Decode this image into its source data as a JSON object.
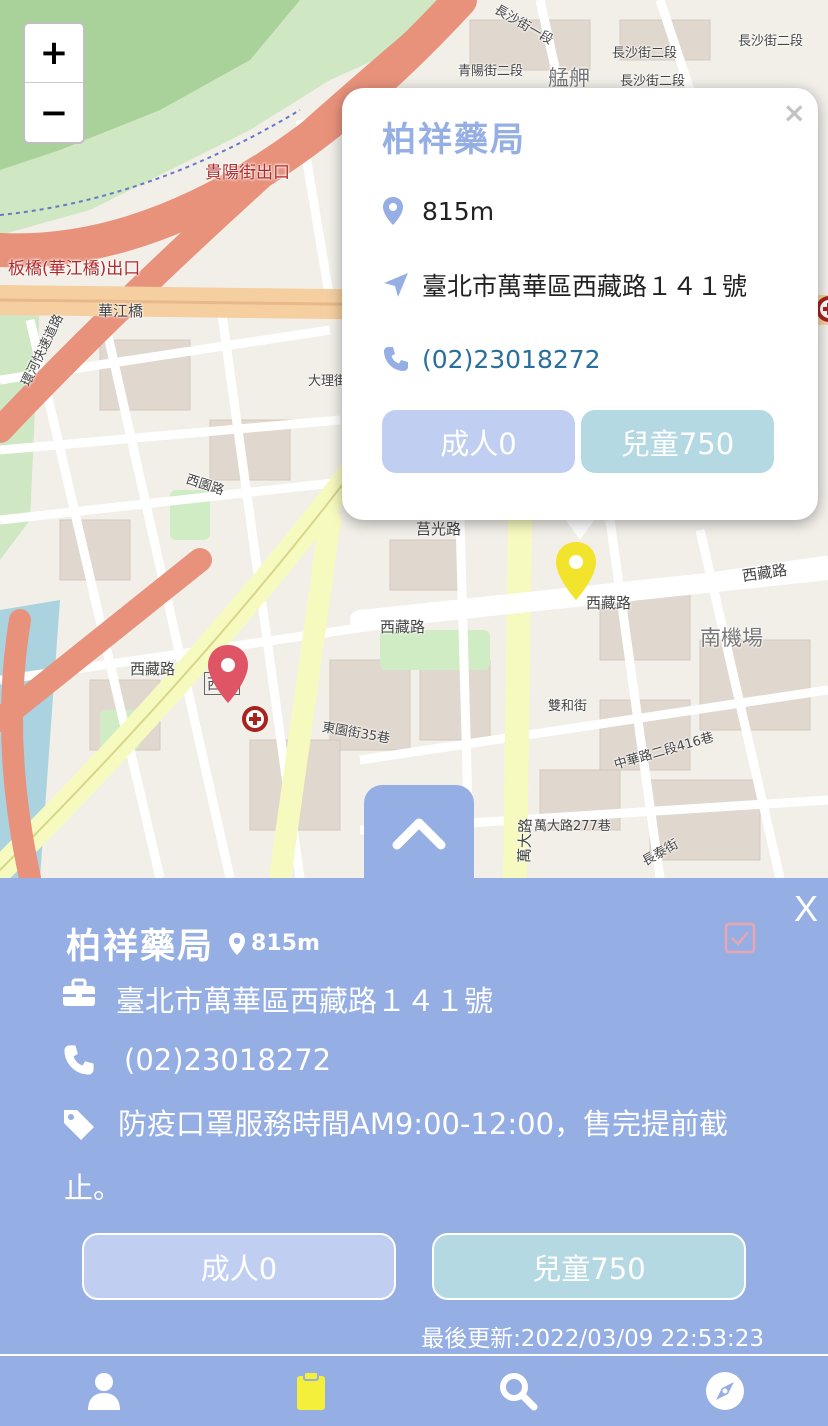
{
  "map": {
    "zoom_in": "+",
    "zoom_out": "−",
    "labels": [
      {
        "text": "長沙街一段",
        "cls": "small"
      },
      {
        "text": "長沙街二段",
        "cls": "small"
      },
      {
        "text": "長沙街二段",
        "cls": "small"
      },
      {
        "text": "長沙街二段",
        "cls": "small"
      },
      {
        "text": "青陽街二段",
        "cls": "small"
      },
      {
        "text": "艋舺",
        "cls": "big"
      },
      {
        "text": "貴陽街出口",
        "cls": "red"
      },
      {
        "text": "板橋(華江橋)出口",
        "cls": "red"
      },
      {
        "text": "華江橋",
        "cls": ""
      },
      {
        "text": "大理街",
        "cls": "small"
      },
      {
        "text": "西園路",
        "cls": "small"
      },
      {
        "text": "莒光路",
        "cls": ""
      },
      {
        "text": "西藏路",
        "cls": ""
      },
      {
        "text": "西藏路",
        "cls": ""
      },
      {
        "text": "西藏路",
        "cls": ""
      },
      {
        "text": "西藏路",
        "cls": ""
      },
      {
        "text": "南機場",
        "cls": "big"
      },
      {
        "text": "雙和街",
        "cls": "small"
      },
      {
        "text": "東園街35巷",
        "cls": "small"
      },
      {
        "text": "萬大路277巷",
        "cls": "small"
      },
      {
        "text": "西園",
        "cls": ""
      },
      {
        "text": "萬大路",
        "cls": ""
      },
      {
        "text": "中華路二段416巷",
        "cls": "small"
      },
      {
        "text": "長泰街",
        "cls": "small"
      },
      {
        "text": "環河快速道路",
        "cls": "small"
      }
    ]
  },
  "popup": {
    "name": "柏祥藥局",
    "close": "×",
    "distance": "815m",
    "address": "臺北市萬華區西藏路１４１號",
    "phone": "(02)23018272",
    "adult_label": "成人0",
    "child_label": "兒童750"
  },
  "panel": {
    "close": "X",
    "name": "柏祥藥局",
    "distance": "815m",
    "address": "臺北市萬華區西藏路１４１號",
    "phone": "(02)23018272",
    "note": "防疫口罩服務時間AM9:00-12:00，售完提前截止。",
    "adult_label": "成人0",
    "child_label": "兒童750",
    "updated": "最後更新:2022/03/09 22:53:23"
  },
  "colors": {
    "primary": "#95aee4",
    "adult": "#c0cff1",
    "child": "#b5d9e2",
    "marker_selected": "#f2e32c",
    "marker_other": "#e05565",
    "nav_active": "#f4ef3a"
  },
  "nav": [
    {
      "icon": "user-icon"
    },
    {
      "icon": "clipboard-icon"
    },
    {
      "icon": "search-icon"
    },
    {
      "icon": "compass-icon"
    }
  ]
}
